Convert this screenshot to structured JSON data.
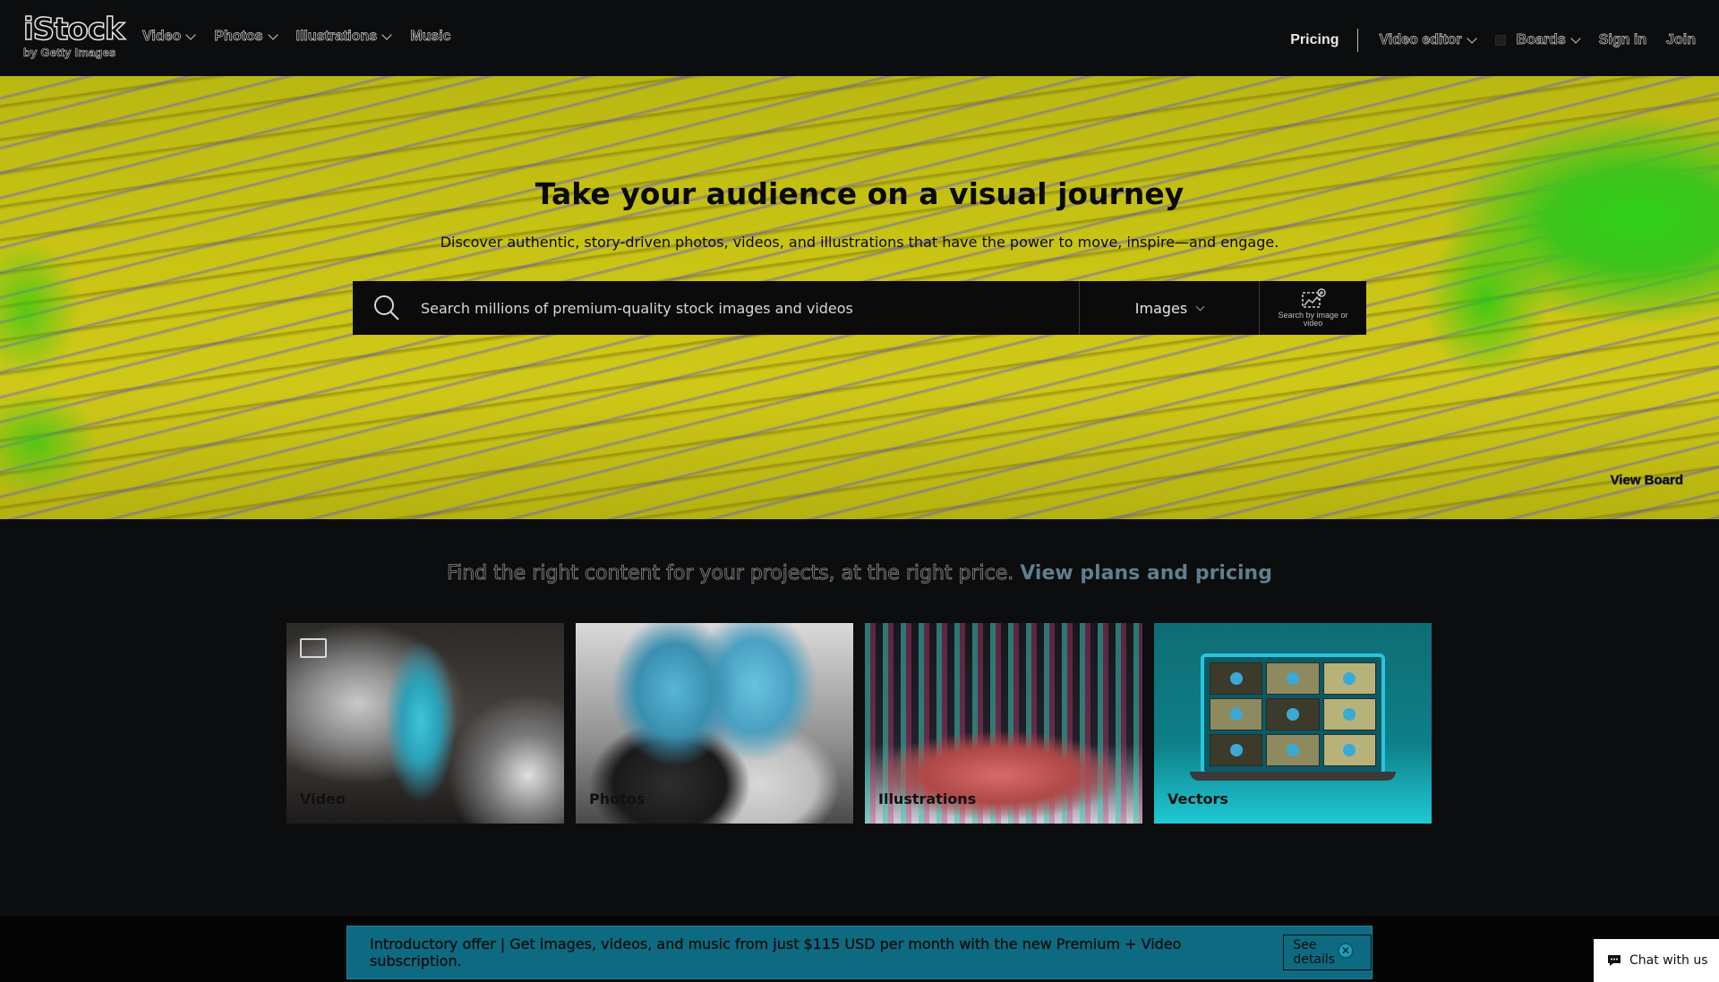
{
  "header": {
    "logo": {
      "main": "iStock",
      "sub": "by Getty Images"
    },
    "nav_left": [
      {
        "label": "Video",
        "dropdown": true
      },
      {
        "label": "Photos",
        "dropdown": true
      },
      {
        "label": "Illustrations",
        "dropdown": true
      },
      {
        "label": "Music",
        "dropdown": false
      }
    ],
    "nav_right": {
      "pricing": "Pricing",
      "video_editor": "Video editor",
      "boards": "Boards",
      "sign_in": "Sign in",
      "join": "Join"
    }
  },
  "hero": {
    "title": "Take your audience on a visual journey",
    "subtitle": "Discover authentic, story-driven photos, videos, and illustrations that have the power to move, inspire—and engage.",
    "search": {
      "placeholder": "Search millions of premium-quality stock images and videos",
      "value": "",
      "type_selected": "Images",
      "image_search_label": "Search by image or video"
    },
    "view_board": "View Board"
  },
  "pricing_line": {
    "text": "Find the right content for your projects, at the right price.",
    "link": "View plans and pricing"
  },
  "categories": [
    {
      "label": "Video",
      "icon": "film-icon"
    },
    {
      "label": "Photos"
    },
    {
      "label": "Illustrations"
    },
    {
      "label": "Vectors"
    }
  ],
  "offer_banner": {
    "text": "Introductory offer | Get images, videos, and music from just $115 USD per month with the new Premium + Video subscription.",
    "button": "See details",
    "close_icon": "close-icon"
  },
  "chat": {
    "label": "Chat with us",
    "icon": "chat-bubble-icon"
  },
  "colors": {
    "header_bg": "#0c0d0e",
    "hero_yellow": "#c9c414",
    "offer_teal": "#0e6a80",
    "link": "#5f7f8f"
  }
}
